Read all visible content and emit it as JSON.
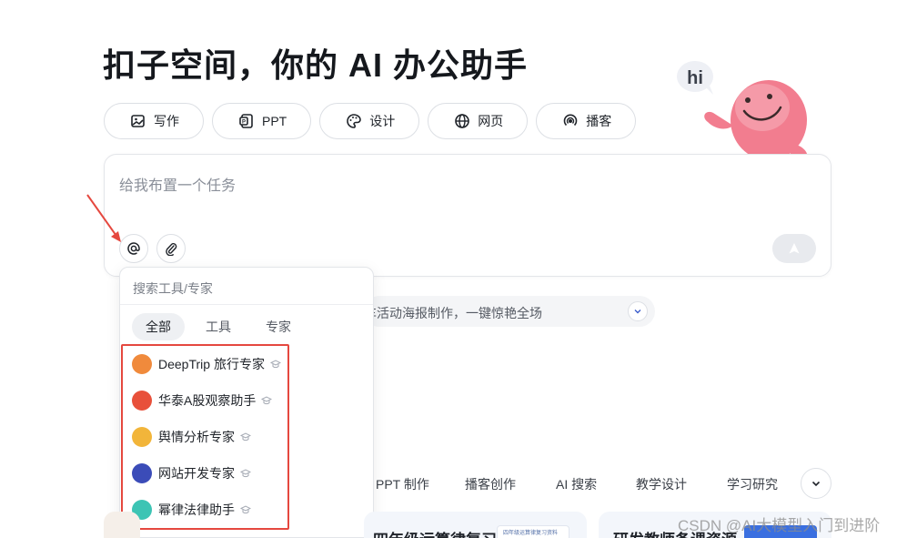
{
  "header": {
    "title": "扣子空间，你的 AI 办公助手"
  },
  "chips": [
    {
      "label": "写作",
      "icon": "image-edit-icon"
    },
    {
      "label": "PPT",
      "icon": "ppt-icon"
    },
    {
      "label": "设计",
      "icon": "palette-icon"
    },
    {
      "label": "网页",
      "icon": "globe-icon"
    },
    {
      "label": "播客",
      "icon": "podcast-icon"
    }
  ],
  "mascot": {
    "greeting": "hi"
  },
  "task": {
    "placeholder": "给我布置一个任务",
    "at_icon": "at-icon",
    "attach_icon": "paperclip-icon",
    "send_icon": "send-arrow-icon"
  },
  "hint": {
    "text": "车活动海报制作，一键惊艳全场"
  },
  "dropdown": {
    "search_placeholder": "搜索工具/专家",
    "tabs": [
      "全部",
      "工具",
      "专家"
    ],
    "active_tab": "全部",
    "items": [
      {
        "name": "DeepTrip 旅行专家",
        "color": "#f08a3c"
      },
      {
        "name": "华泰A股观察助手",
        "color": "#e8503a"
      },
      {
        "name": "舆情分析专家",
        "color": "#f2b53a"
      },
      {
        "name": "网站开发专家",
        "color": "#3b4cb8"
      },
      {
        "name": "幂律法律助手",
        "color": "#3cc4b4"
      }
    ]
  },
  "categories": [
    "PPT 制作",
    "播客创作",
    "AI 搜索",
    "教学设计",
    "学习研究"
  ],
  "cards": {
    "mid_text": "四年级运算律复习",
    "mid_thumb": "四年级运算律复习资料",
    "right_text": "研发教师备课资源"
  },
  "watermark": "CSDN @AI大模型入门到进阶",
  "colors": {
    "accent_red": "#e5483f",
    "mascot_pink": "#f27d8f"
  }
}
